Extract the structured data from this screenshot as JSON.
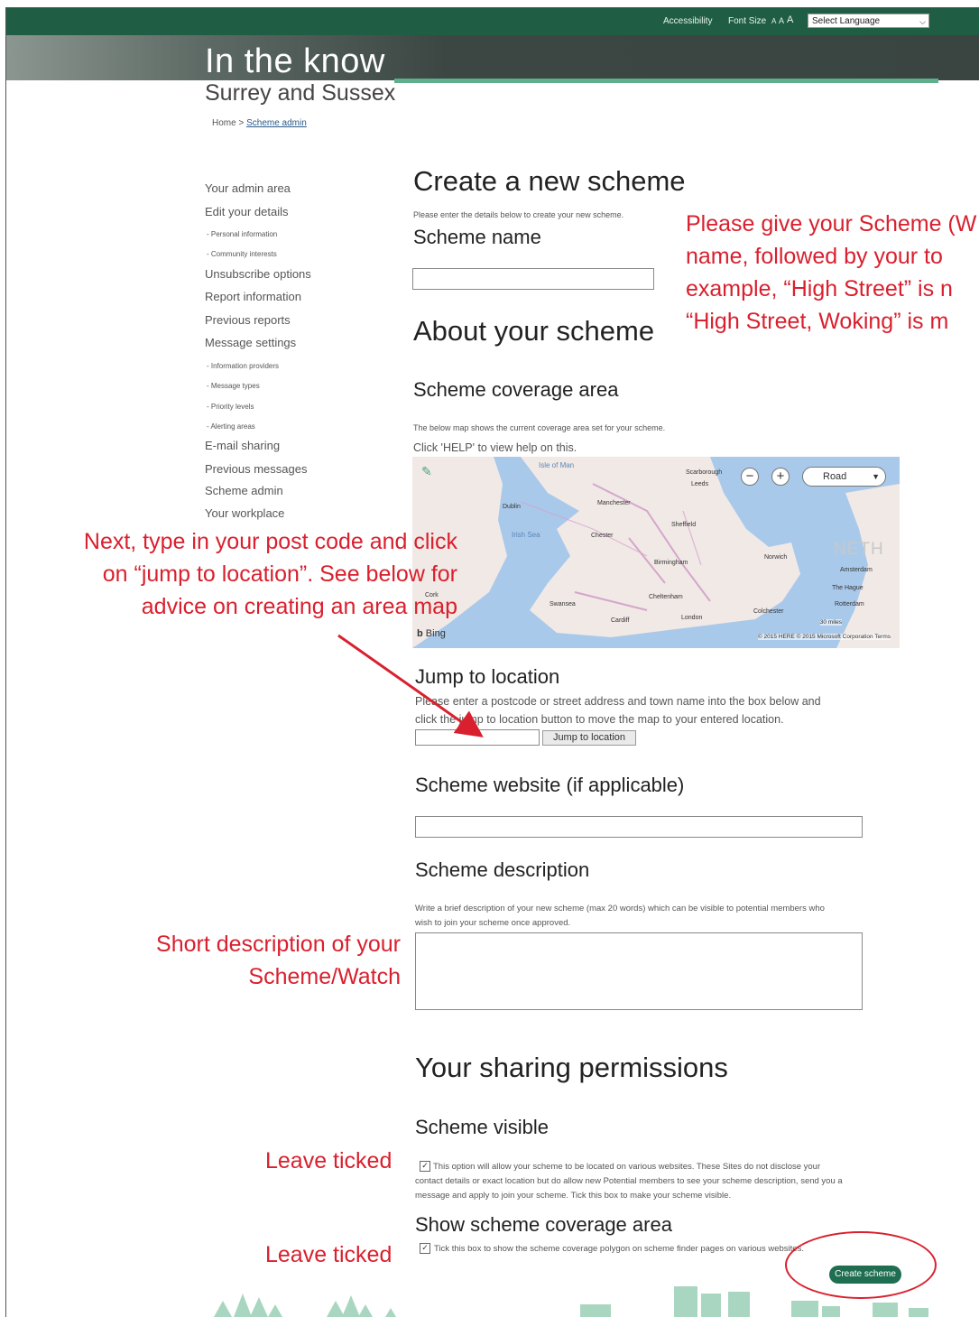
{
  "topbar": {
    "accessibility": "Accessibility",
    "font_size": "Font Size",
    "font_sizes": [
      "A",
      "A",
      "A"
    ],
    "language": "Select Language"
  },
  "header": {
    "title": "In the know",
    "subtitle": "Surrey and Sussex"
  },
  "breadcrumb": {
    "home": "Home",
    "sep": ">",
    "current": "Scheme admin"
  },
  "sidebar": {
    "items": [
      {
        "label": "Your admin area",
        "level": "main"
      },
      {
        "label": "Edit your details",
        "level": "main"
      },
      {
        "label": "- Personal information",
        "level": "sub"
      },
      {
        "label": "- Community interests",
        "level": "sub"
      },
      {
        "label": "Unsubscribe options",
        "level": "main"
      },
      {
        "label": "Report information",
        "level": "main"
      },
      {
        "label": "Previous reports",
        "level": "main"
      },
      {
        "label": "Message settings",
        "level": "main"
      },
      {
        "label": "- Information providers",
        "level": "sub"
      },
      {
        "label": "- Message types",
        "level": "sub"
      },
      {
        "label": "- Priority levels",
        "level": "sub"
      },
      {
        "label": "- Alerting areas",
        "level": "sub"
      },
      {
        "label": "E-mail sharing",
        "level": "main"
      },
      {
        "label": "Previous messages",
        "level": "main"
      },
      {
        "label": "Scheme admin",
        "level": "main"
      },
      {
        "label": "Your workplace",
        "level": "main"
      }
    ]
  },
  "main": {
    "title": "Create a new scheme",
    "intro": "Please enter the details below to create your new scheme.",
    "scheme_name_label": "Scheme name",
    "about_heading": "About your scheme",
    "coverage_heading": "Scheme coverage area",
    "coverage_info": "The below map shows the current coverage area set for your scheme.",
    "coverage_help": "Click 'HELP' to view help on this.",
    "jump_heading": "Jump to location",
    "jump_help_line1": "Please enter a postcode or street address and town name into the box below and",
    "jump_help_line2": "click the jump to location button to move the map to your entered location.",
    "jump_button": "Jump to location",
    "website_heading": "Scheme website (if applicable)",
    "description_heading": "Scheme description",
    "description_help_line1": "Write a brief description of your new scheme (max 20 words) which can be visible to potential members who",
    "description_help_line2": "wish to join your scheme once approved.",
    "sharing_heading": "Your sharing permissions",
    "visible_heading": "Scheme visible",
    "visible_text_line1": "This option will allow your scheme to be located on various websites. These Sites do not disclose your",
    "visible_text_line2": "contact details or exact location but do allow new Potential members to see your scheme description, send you a",
    "visible_text_line3": "message and apply to join your scheme. Tick this box to make your scheme visible.",
    "coverage_show_heading": "Show scheme coverage area",
    "coverage_show_text": "Tick this box to show the scheme coverage polygon on scheme finder pages on various websites.",
    "create_button": "Create scheme"
  },
  "map": {
    "road_label": "Road",
    "zoom_out": "−",
    "zoom_in": "+",
    "bing": "Bing",
    "copyright": "© 2015 HERE © 2015 Microsoft Corporation  Terms",
    "country": "NETH",
    "scale": "30 miles",
    "cities": [
      "Manchester",
      "Leeds",
      "Sheffield",
      "Birmingham",
      "Cheltenham",
      "London",
      "Cardiff",
      "Norwich",
      "Amsterdam",
      "Rotterdam",
      "Dublin",
      "Scarborough",
      "Swansea",
      "Chester",
      "Cork",
      "Colchester",
      "The Hague"
    ],
    "seas": [
      "Isle of Man",
      "Irish Sea"
    ]
  },
  "annotations": {
    "name_note": [
      "Please give your Scheme (W",
      "name,  followed by your to",
      "example, “High Street” is n",
      "“High Street,  Woking” is m"
    ],
    "postcode_note": [
      "Next, type in your post code and click",
      "on “jump to location”. See below for",
      "advice on creating an area map"
    ],
    "description_note": [
      "Short  description of your",
      "Scheme/Watch"
    ],
    "tick_note_1": "Leave ticked",
    "tick_note_2": "Leave ticked"
  },
  "colors": {
    "brand_green": "#1f5e45",
    "accent_green": "#5fae8c",
    "annotation_red": "#d9202e"
  }
}
